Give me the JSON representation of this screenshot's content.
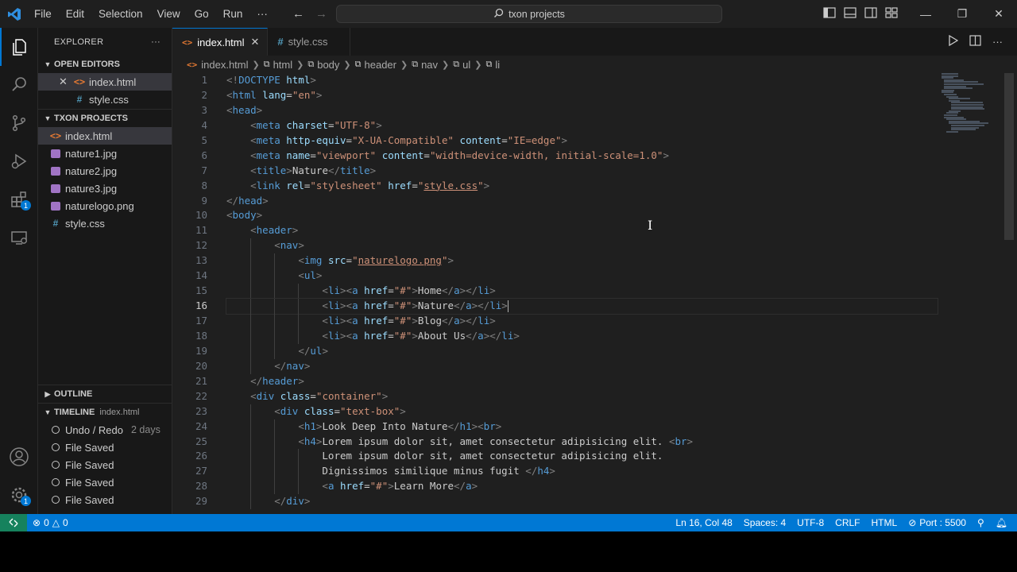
{
  "titlebar": {
    "menu": [
      "File",
      "Edit",
      "Selection",
      "View",
      "Go",
      "Run",
      "···"
    ],
    "search_text": "txon projects"
  },
  "explorer": {
    "title": "EXPLORER",
    "more": "···",
    "open_editors": {
      "label": "OPEN EDITORS",
      "items": [
        {
          "name": "index.html",
          "icon": "html-file-icon",
          "close": "✕"
        },
        {
          "name": "style.css",
          "icon": "css-file-icon"
        }
      ]
    },
    "project": {
      "label": "TXON PROJECTS",
      "files": [
        {
          "name": "index.html",
          "icon": "html-file-icon"
        },
        {
          "name": "nature1.jpg",
          "icon": "image-file-icon"
        },
        {
          "name": "nature2.jpg",
          "icon": "image-file-icon"
        },
        {
          "name": "nature3.jpg",
          "icon": "image-file-icon"
        },
        {
          "name": "naturelogo.png",
          "icon": "image-file-icon"
        },
        {
          "name": "style.css",
          "icon": "css-file-icon"
        }
      ]
    },
    "outline_label": "OUTLINE",
    "timeline": {
      "label": "TIMELINE",
      "file": "index.html",
      "entries": [
        {
          "label": "Undo / Redo",
          "time": "2 days"
        },
        {
          "label": "File Saved",
          "time": ""
        },
        {
          "label": "File Saved",
          "time": ""
        },
        {
          "label": "File Saved",
          "time": ""
        },
        {
          "label": "File Saved",
          "time": ""
        }
      ]
    }
  },
  "activity_badges": {
    "extensions": "1",
    "settings": "1"
  },
  "tabs": [
    {
      "label": "index.html",
      "icon": "html-file-icon",
      "active": true,
      "close": "✕"
    },
    {
      "label": "style.css",
      "icon": "css-file-icon",
      "active": false
    }
  ],
  "breadcrumb": [
    "index.html",
    "html",
    "body",
    "header",
    "nav",
    "ul",
    "li"
  ],
  "editor": {
    "current_line": 16,
    "line_numbers": [
      "1",
      "2",
      "3",
      "4",
      "5",
      "6",
      "7",
      "8",
      "9",
      "10",
      "11",
      "12",
      "13",
      "14",
      "15",
      "16",
      "17",
      "18",
      "19",
      "20",
      "21",
      "22",
      "23",
      "24",
      "25",
      "26",
      "27",
      "28",
      "29"
    ]
  },
  "statusbar": {
    "errors": "0",
    "warnings": "0",
    "position": "Ln 16, Col 48",
    "spaces": "Spaces: 4",
    "encoding": "UTF-8",
    "eol": "CRLF",
    "language": "HTML",
    "port": "Port : 5500"
  },
  "colors": {
    "accent": "#0078d4",
    "tag": "#569cd6",
    "attribute": "#9cdcfe",
    "string": "#ce9178",
    "bracket": "#808080",
    "remote": "#16825d"
  }
}
